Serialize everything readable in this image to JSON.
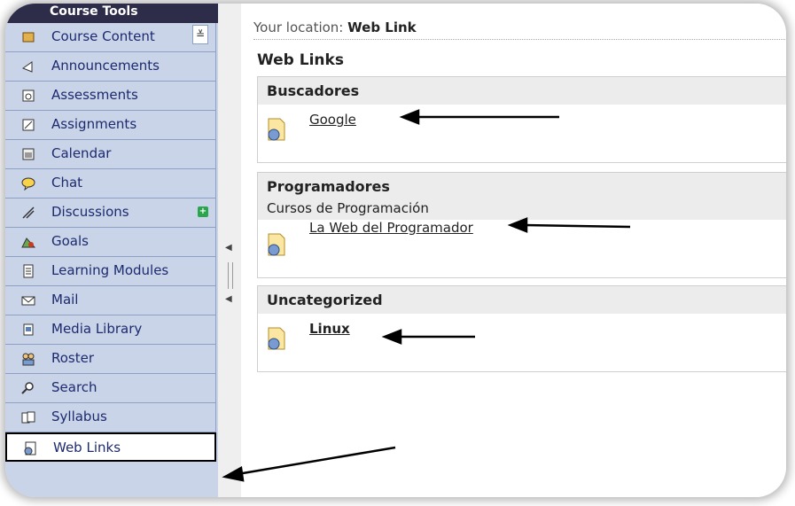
{
  "nav": {
    "title": "Course Tools",
    "items": [
      {
        "label": "Course Content",
        "icon": "course-content-icon"
      },
      {
        "label": "Announcements",
        "icon": "announcements-icon"
      },
      {
        "label": "Assessments",
        "icon": "assessments-icon"
      },
      {
        "label": "Assignments",
        "icon": "assignments-icon"
      },
      {
        "label": "Calendar",
        "icon": "calendar-icon"
      },
      {
        "label": "Chat",
        "icon": "chat-icon"
      },
      {
        "label": "Discussions",
        "icon": "discussions-icon"
      },
      {
        "label": "Goals",
        "icon": "goals-icon"
      },
      {
        "label": "Learning Modules",
        "icon": "learning-modules-icon"
      },
      {
        "label": "Mail",
        "icon": "mail-icon"
      },
      {
        "label": "Media Library",
        "icon": "media-library-icon"
      },
      {
        "label": "Roster",
        "icon": "roster-icon"
      },
      {
        "label": "Search",
        "icon": "search-icon"
      },
      {
        "label": "Syllabus",
        "icon": "syllabus-icon"
      },
      {
        "label": "Web Links",
        "icon": "web-links-icon"
      }
    ],
    "active": "Web Links",
    "collapse_glyph": "≚"
  },
  "content": {
    "location_prefix": "Your location:",
    "location_value": "Web Link",
    "title": "Web Links",
    "categories": [
      {
        "name": "Buscadores",
        "description": "",
        "links": [
          {
            "label": "Google"
          }
        ]
      },
      {
        "name": "Programadores",
        "description": "Cursos de Programación",
        "links": [
          {
            "label": "La Web del Programador"
          }
        ]
      },
      {
        "name": "Uncategorized",
        "description": "",
        "links": [
          {
            "label": "Linux"
          }
        ]
      }
    ]
  },
  "colors": {
    "nav_bg": "#c9d4e8",
    "nav_title_bg": "#2d2d4a",
    "category_header_bg": "#ececec"
  }
}
